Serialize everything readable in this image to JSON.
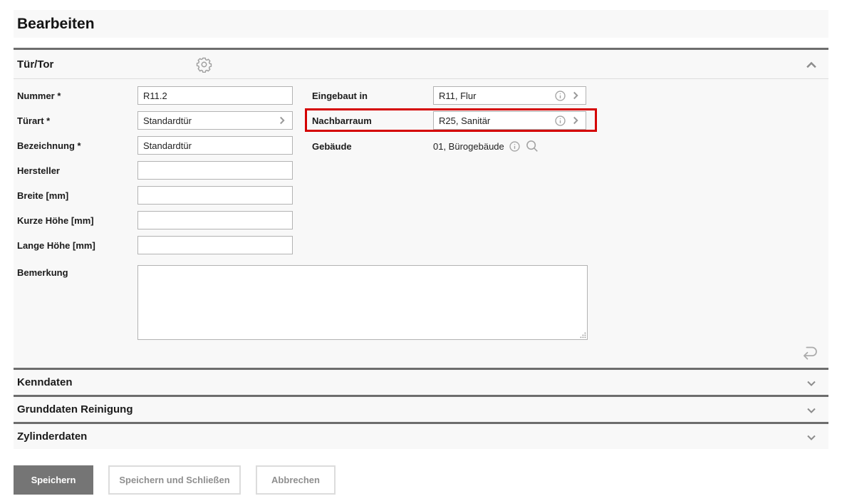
{
  "page": {
    "title": "Bearbeiten"
  },
  "colors": {
    "highlight_red": "#d40000",
    "panel_bg": "#f8f8f8",
    "divider_dark": "#6d6d6d",
    "primary_button_bg": "#757575"
  },
  "sections": {
    "tuertor": {
      "label": "Tür/Tor",
      "fields_left": [
        {
          "label": "Nummer *",
          "value": "R11.2"
        },
        {
          "label": "Türart *",
          "value": "Standardtür"
        },
        {
          "label": "Bezeichnung *",
          "value": "Standardtür"
        },
        {
          "label": "Hersteller",
          "value": ""
        },
        {
          "label": "Breite [mm]",
          "value": ""
        },
        {
          "label": "Kurze Höhe [mm]",
          "value": ""
        },
        {
          "label": "Lange Höhe [mm]",
          "value": ""
        }
      ],
      "bemerkung": {
        "label": "Bemerkung",
        "value": ""
      },
      "fields_right": [
        {
          "label": "Eingebaut in",
          "value": "R11, Flur",
          "highlighted": false
        },
        {
          "label": "Nachbarraum",
          "value": "R25, Sanitär",
          "highlighted": true
        },
        {
          "label": "Gebäude",
          "value": "01, Bürogebäude"
        }
      ]
    },
    "collapsed": [
      {
        "label": "Kenndaten"
      },
      {
        "label": "Grunddaten Reinigung"
      },
      {
        "label": "Zylinderdaten"
      }
    ]
  },
  "buttons": {
    "save": "Speichern",
    "save_close": "Speichern und Schließen",
    "cancel": "Abbrechen"
  }
}
